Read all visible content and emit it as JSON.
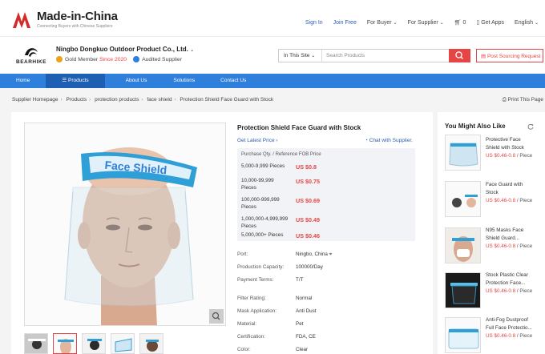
{
  "site": {
    "logo_title": "Made-in-China",
    "logo_sub": "Connecting Buyers with Chinese Suppliers"
  },
  "toplinks": {
    "sign_in": "Sign In",
    "join": "Join Free",
    "buyer": "For Buyer",
    "supplier": "For Supplier",
    "cart_count": "0",
    "apps": "Get Apps",
    "language": "English"
  },
  "supplier": {
    "brand": "BEARHIKE",
    "company": "Ningbo Dongkuo Outdoor Product Co., Ltd.",
    "gold_label": "Gold Member",
    "since": "Since 2020",
    "audited": "Audited Supplier"
  },
  "search": {
    "scope": "In This Site",
    "placeholder": "Search Products",
    "post_label": "Post Sourcing Request"
  },
  "nav": {
    "items": [
      "Home",
      "Products",
      "About Us",
      "Solutions",
      "Contact Us"
    ]
  },
  "breadcrumb": {
    "items": [
      "Supplier Homepage",
      "Products",
      "protection products",
      "face shield",
      "Protection Shield Face Guard with Stock"
    ],
    "print": "Print This Page"
  },
  "product": {
    "title": "Protection Shield Face Guard with Stock",
    "shield_text": "Face Shield",
    "latest_price": "Get Latest Price",
    "chat": "Chat with Supplier.",
    "price_header": "Purchase Qty. / Reference FOB Price",
    "prices": [
      {
        "qty": "5,000-9,999 Pieces",
        "price": "US $0.8"
      },
      {
        "qty": "10,000-99,999 Pieces",
        "price": "US $0.75"
      },
      {
        "qty": "100,000-999,999 Pieces",
        "price": "US $0.69"
      },
      {
        "qty": "1,000,000-4,999,999 Pieces",
        "price": "US $0.49"
      },
      {
        "qty": "5,000,000+ Pieces",
        "price": "US $0.46"
      }
    ],
    "specs": [
      {
        "label": "Port:",
        "value": "Ningbo, China"
      },
      {
        "label": "Production Capacity:",
        "value": "100000/Day"
      },
      {
        "label": "Payment Terms:",
        "value": "T/T"
      },
      {
        "label": "Filter Rating:",
        "value": "Normal"
      },
      {
        "label": "Mask Application:",
        "value": "Anti Dust"
      },
      {
        "label": "Material:",
        "value": "Pet"
      },
      {
        "label": "Certification:",
        "value": "FDA, CE"
      },
      {
        "label": "Color:",
        "value": "Clear"
      }
    ]
  },
  "sidebar": {
    "title": "You Might Also Like",
    "items": [
      {
        "name": "Protective Face Shield with Stock",
        "price": "US $0.46-0.8",
        "unit": "/ Piece"
      },
      {
        "name": "Face Guard with Stock",
        "price": "US $0.46-0.8",
        "unit": "/ Piece"
      },
      {
        "name": "N95 Masks Face Shield Guard...",
        "price": "US $0.46-0.8",
        "unit": "/ Piece"
      },
      {
        "name": "Stock Plastic Clear Protection Face...",
        "price": "US $0.46-0.8",
        "unit": "/ Piece"
      },
      {
        "name": "Anti-Fog Dustproof Full Face Protectio...",
        "price": "US $0.46-0.8",
        "unit": "/ Piece"
      }
    ]
  },
  "colors": {
    "accent_red": "#e64545",
    "nav_blue": "#2f7fdc",
    "link_blue": "#2a5db0"
  }
}
